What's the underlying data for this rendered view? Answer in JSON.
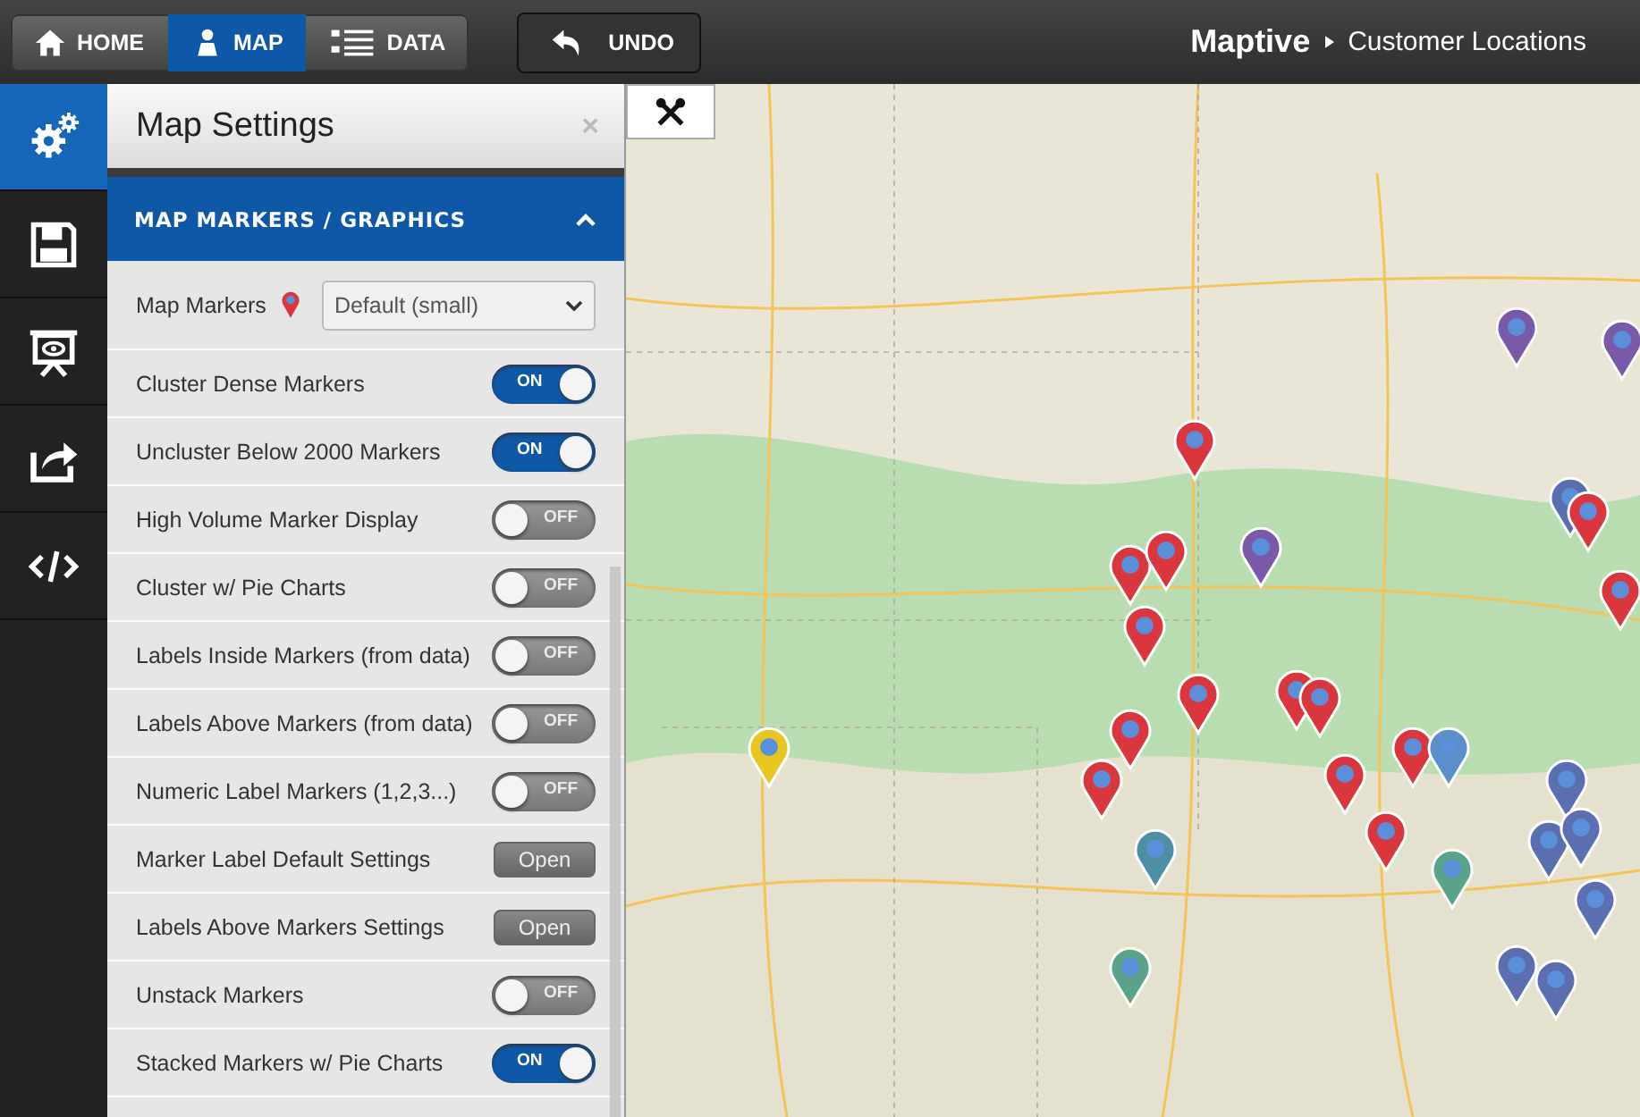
{
  "nav": {
    "tabs": [
      {
        "label": "HOME",
        "kind": "home",
        "selected": false
      },
      {
        "label": "MAP",
        "kind": "map",
        "selected": true
      },
      {
        "label": "DATA",
        "kind": "data",
        "selected": false
      }
    ],
    "undo": "UNDO"
  },
  "breadcrumb": {
    "brand": "Maptive",
    "page": "Customer Locations"
  },
  "rail": [
    {
      "kind": "settings",
      "selected": true
    },
    {
      "kind": "save",
      "selected": false
    },
    {
      "kind": "present",
      "selected": false
    },
    {
      "kind": "share",
      "selected": false
    },
    {
      "kind": "embed",
      "selected": false
    }
  ],
  "panel": {
    "title": "Map Settings",
    "close": "×",
    "section": {
      "title": "MAP MARKERS / GRAPHICS",
      "expanded": true
    },
    "rows": [
      {
        "kind": "select",
        "label": "Map Markers",
        "value": "Default (small)"
      },
      {
        "kind": "toggle",
        "label": "Cluster Dense Markers",
        "on": true,
        "state_label": "ON"
      },
      {
        "kind": "toggle",
        "label": "Uncluster Below 2000 Markers",
        "on": true,
        "state_label": "ON"
      },
      {
        "kind": "toggle",
        "label": "High Volume Marker Display",
        "on": false,
        "state_label": "OFF"
      },
      {
        "kind": "toggle",
        "label": "Cluster w/ Pie Charts",
        "on": false,
        "state_label": "OFF"
      },
      {
        "kind": "toggle",
        "label": "Labels Inside Markers (from data)",
        "on": false,
        "state_label": "OFF"
      },
      {
        "kind": "toggle",
        "label": "Labels Above Markers (from data)",
        "on": false,
        "state_label": "OFF"
      },
      {
        "kind": "toggle",
        "label": "Numeric Label Markers (1,2,3...)",
        "on": false,
        "state_label": "OFF"
      },
      {
        "kind": "button",
        "label": "Marker Label Default Settings",
        "button": "Open"
      },
      {
        "kind": "button",
        "label": "Labels Above Markers Settings",
        "button": "Open"
      },
      {
        "kind": "toggle",
        "label": "Unstack Markers",
        "on": false,
        "state_label": "OFF"
      },
      {
        "kind": "toggle",
        "label": "Stacked Markers w/ Pie Charts",
        "on": true,
        "state_label": "ON"
      }
    ]
  }
}
